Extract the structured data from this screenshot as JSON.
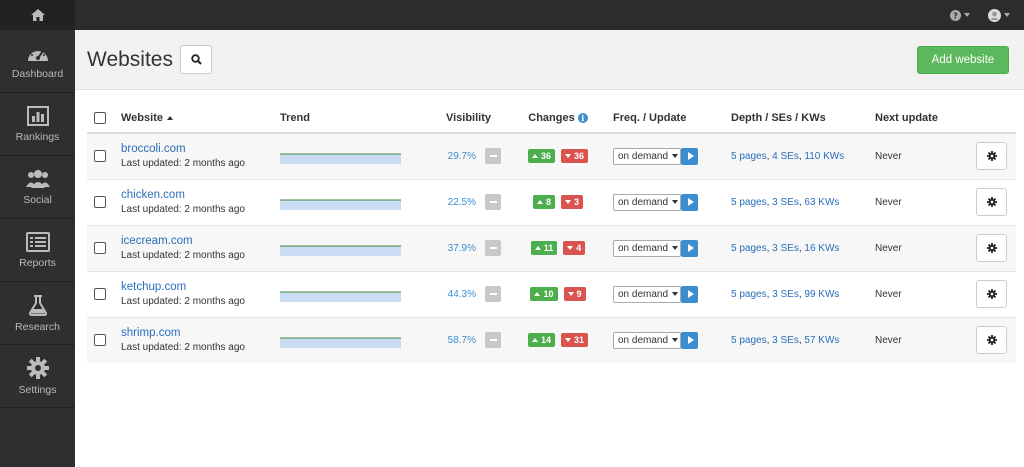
{
  "sidebar": {
    "items": [
      {
        "label": "Dashboard",
        "icon": "gauge-icon"
      },
      {
        "label": "Rankings",
        "icon": "bar-chart-icon"
      },
      {
        "label": "Social",
        "icon": "users-icon"
      },
      {
        "label": "Reports",
        "icon": "report-icon"
      },
      {
        "label": "Research",
        "icon": "flask-icon"
      },
      {
        "label": "Settings",
        "icon": "gear-icon"
      }
    ]
  },
  "header": {
    "title": "Websites",
    "add_label": "Add website"
  },
  "table": {
    "columns": {
      "website": "Website",
      "trend": "Trend",
      "visibility": "Visibility",
      "changes": "Changes",
      "freq": "Freq. / Update",
      "depth": "Depth / SEs / KWs",
      "next": "Next update"
    },
    "rows": [
      {
        "site": "broccoli.com",
        "updated": "Last updated: 2 months ago",
        "visibility": "29.7%",
        "up": "36",
        "down": "36",
        "freq": "on demand",
        "pages": "5 pages",
        "ses": "4 SEs",
        "kws": "110 KWs",
        "next": "Never"
      },
      {
        "site": "chicken.com",
        "updated": "Last updated: 2 months ago",
        "visibility": "22.5%",
        "up": "8",
        "down": "3",
        "freq": "on demand",
        "pages": "5 pages",
        "ses": "3 SEs",
        "kws": "63 KWs",
        "next": "Never"
      },
      {
        "site": "icecream.com",
        "updated": "Last updated: 2 months ago",
        "visibility": "37.9%",
        "up": "11",
        "down": "4",
        "freq": "on demand",
        "pages": "5 pages",
        "ses": "3 SEs",
        "kws": "16 KWs",
        "next": "Never"
      },
      {
        "site": "ketchup.com",
        "updated": "Last updated: 2 months ago",
        "visibility": "44.3%",
        "up": "10",
        "down": "9",
        "freq": "on demand",
        "pages": "5 pages",
        "ses": "3 SEs",
        "kws": "99 KWs",
        "next": "Never"
      },
      {
        "site": "shrimp.com",
        "updated": "Last updated: 2 months ago",
        "visibility": "58.7%",
        "up": "14",
        "down": "31",
        "freq": "on demand",
        "pages": "5 pages",
        "ses": "3 SEs",
        "kws": "57 KWs",
        "next": "Never"
      }
    ]
  },
  "colors": {
    "accent_green": "#5cb85c",
    "link_blue": "#2a6ebb",
    "down_red": "#d9534f",
    "sidebar_bg": "#2f2f2f"
  }
}
